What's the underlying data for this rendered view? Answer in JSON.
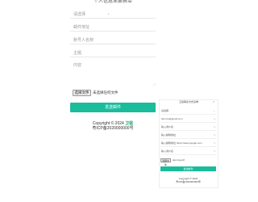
{
  "form": {
    "title": "个人信息采集表单",
    "select_placeholder": "请选择",
    "email_placeholder": "邮件地址",
    "username_placeholder": "账号人名称",
    "subject_placeholder": "主题",
    "message_placeholder": "内容",
    "file_button": "选择文件",
    "file_status": "未选择任何文件",
    "submit_label": "发送邮件",
    "copyright": "Copyright © 2024",
    "brand": "卫蓝",
    "icp": "粤ICP备2020000000号"
  },
  "panel": {
    "title": "卫蓝联系方式表单",
    "close": "×",
    "rows": [
      {
        "label": "请选择",
        "icon": "⌄"
      },
      {
        "label": "dummy@gmail.com",
        "icon": "×"
      },
      {
        "label": "输入用户名",
        "icon": "×"
      },
      {
        "label": "输入邮箱地址",
        "icon": "×"
      },
      {
        "label": "输入邮箱地址 https://www.google.com",
        "icon": "×"
      },
      {
        "label": "输入用户名",
        "icon": "×"
      }
    ],
    "file_button": "选择文件",
    "file_status": "dummy.pdf",
    "submit_label": "发送邮件",
    "copyright": "Copyright © 2024",
    "icp": "粤ICP备2020000000号"
  }
}
